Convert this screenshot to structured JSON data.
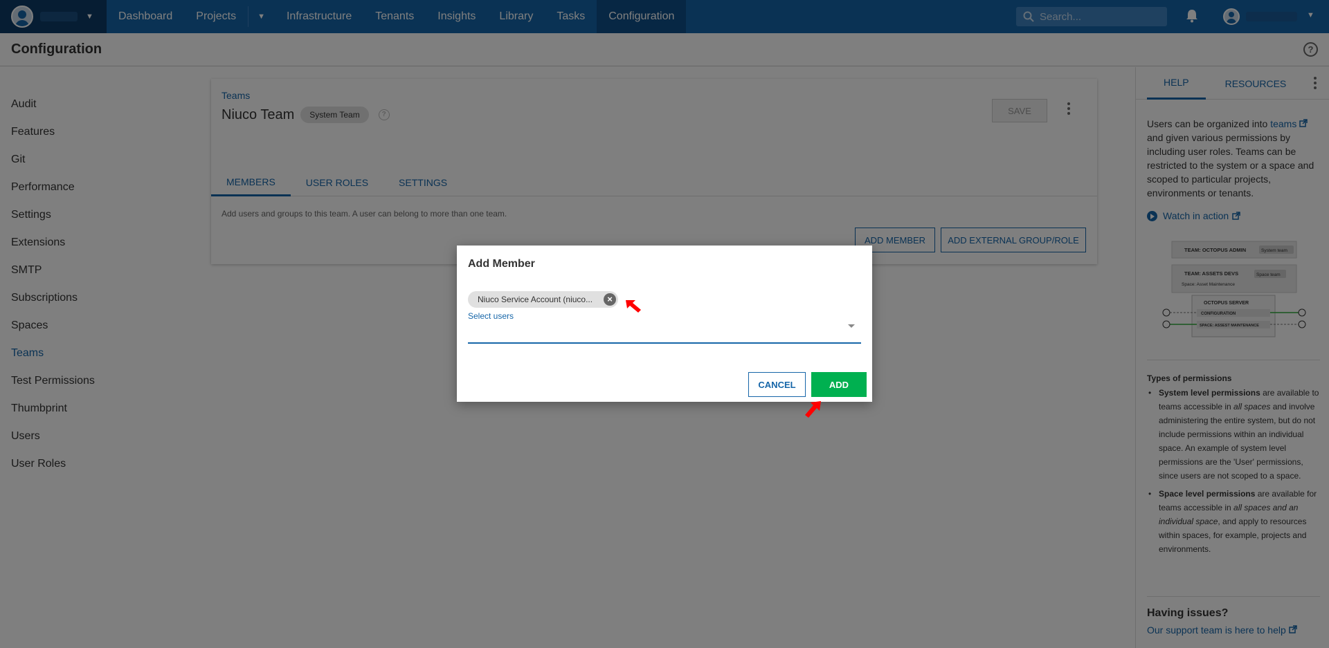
{
  "topnav": {
    "items": [
      {
        "label": "Dashboard"
      },
      {
        "label": "Projects"
      },
      {
        "label": "Infrastructure"
      },
      {
        "label": "Tenants"
      },
      {
        "label": "Insights"
      },
      {
        "label": "Library"
      },
      {
        "label": "Tasks"
      },
      {
        "label": "Configuration"
      }
    ],
    "search_placeholder": "Search..."
  },
  "page": {
    "title": "Configuration",
    "help_label": "?"
  },
  "sidebar": {
    "items": [
      {
        "label": "Audit"
      },
      {
        "label": "Features"
      },
      {
        "label": "Git"
      },
      {
        "label": "Performance"
      },
      {
        "label": "Settings"
      },
      {
        "label": "Extensions"
      },
      {
        "label": "SMTP"
      },
      {
        "label": "Subscriptions"
      },
      {
        "label": "Spaces"
      },
      {
        "label": "Teams"
      },
      {
        "label": "Test Permissions"
      },
      {
        "label": "Thumbprint"
      },
      {
        "label": "Users"
      },
      {
        "label": "User Roles"
      }
    ]
  },
  "team": {
    "breadcrumb": "Teams",
    "name": "Niuco Team",
    "chip": "System Team",
    "help_label": "?",
    "save_label": "SAVE",
    "tabs": [
      {
        "label": "MEMBERS"
      },
      {
        "label": "USER ROLES"
      },
      {
        "label": "SETTINGS"
      }
    ],
    "description": "Add users and groups to this team. A user can belong to more than one team.",
    "add_member_label": "ADD MEMBER",
    "add_external_label": "ADD EXTERNAL GROUP/ROLE"
  },
  "help_panel": {
    "tabs": [
      {
        "label": "HELP"
      },
      {
        "label": "RESOURCES"
      }
    ],
    "intro_before": "Users can be organized into ",
    "intro_link": "teams",
    "intro_after": " and given various permissions by including user roles. Teams can be restricted to the system or a space and scoped to particular projects, environments or tenants.",
    "watch_label": "Watch in action",
    "diagram": {
      "team1": "TEAM: OCTOPUS ADMIN",
      "team1_tag": "System team",
      "team2": "TEAM: ASSETS DEVS",
      "team2_tag": "Space team",
      "team2_space": "Space: Asset Maintenance",
      "server": "OCTOPUS SERVER",
      "config": "CONFIGURATION",
      "space": "SPACE: ASSEST MAINTENANCE"
    },
    "types_title": "Types of permissions",
    "system_bold": "System level permissions",
    "system_text1": " are available to teams accessible in ",
    "system_em": "all spaces",
    "system_text2": " and involve administering the entire system, but do not include permissions within an individual space. An example of system level permissions are the 'User' permissions, since users are not scoped to a space.",
    "space_bold": "Space level permissions",
    "space_text1": " are available for teams accessible in ",
    "space_em": "all spaces and an individual space",
    "space_text2": ", and apply to resources within spaces, for example, projects and environments.",
    "having_issues": "Having issues?",
    "support_label": "Our support team is here to help"
  },
  "dialog": {
    "title": "Add Member",
    "chip_label": "Niuco Service Account (niuco...",
    "chip_remove": "×",
    "select_label": "Select users",
    "cancel_label": "CANCEL",
    "add_label": "ADD"
  },
  "colors": {
    "nav_bg": "#1565a8",
    "accent": "#1565a8",
    "add_button": "#00b050",
    "annotation_arrow": "#ff0000"
  }
}
